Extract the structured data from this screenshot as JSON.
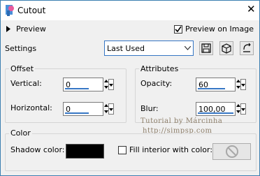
{
  "window": {
    "title": "Cutout",
    "close_glyph": "✕"
  },
  "top": {
    "preview_label": "Preview",
    "preview_on_image_label": "Preview on Image",
    "preview_on_image_checked": true
  },
  "settings": {
    "label": "Settings",
    "preset_value": "Last Used",
    "buttons": [
      "save-preset-icon",
      "load-preset-icon",
      "reset-icon"
    ]
  },
  "offset": {
    "legend": "Offset",
    "vertical_label": "Vertical:",
    "vertical_value": "0",
    "horizontal_label": "Horizontal:",
    "horizontal_value": "0"
  },
  "attributes": {
    "legend": "Attributes",
    "opacity_label": "Opacity:",
    "opacity_value": "60",
    "blur_label": "Blur:",
    "blur_value": "100,00"
  },
  "color": {
    "legend": "Color",
    "shadow_color_label": "Shadow color:",
    "shadow_color": "#000000",
    "fill_interior_label": "Fill interior with color:",
    "fill_interior_checked": false
  },
  "watermark": {
    "line1": "Tutorial by Márcinha",
    "line2": "http://simpsp.com"
  },
  "colors": {
    "accent": "#3676c4",
    "window_border": "#3c7fb1"
  }
}
